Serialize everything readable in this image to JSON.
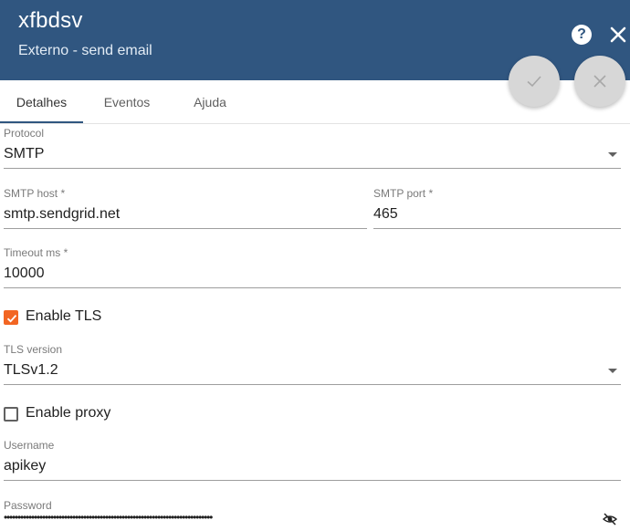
{
  "header": {
    "title": "xfbdsv",
    "subtitle": "Externo - send email",
    "help_glyph": "?",
    "icons": [
      "help-icon",
      "close-icon",
      "check-icon",
      "cancel-icon"
    ],
    "color": "#305680"
  },
  "tabs": [
    {
      "label": "Detalhes",
      "active": true
    },
    {
      "label": "Eventos",
      "active": false
    },
    {
      "label": "Ajuda",
      "active": false
    }
  ],
  "form": {
    "protocol": {
      "label": "Protocol",
      "value": "SMTP"
    },
    "smtp_host": {
      "label": "SMTP host *",
      "value": "smtp.sendgrid.net"
    },
    "smtp_port": {
      "label": "SMTP port *",
      "value": "465"
    },
    "timeout": {
      "label": "Timeout ms *",
      "value": "10000"
    },
    "enable_tls": {
      "label": "Enable TLS",
      "checked": true
    },
    "tls_version": {
      "label": "TLS version",
      "value": "TLSv1.2"
    },
    "enable_proxy": {
      "label": "Enable proxy",
      "checked": false
    },
    "username": {
      "label": "Username",
      "value": "apikey"
    },
    "password": {
      "label": "Password",
      "value": "••••••••••••••••••••••••••••••••••••••••••••••••••••••••••••••••••••••••••••"
    }
  },
  "accent_color": "#f26522"
}
